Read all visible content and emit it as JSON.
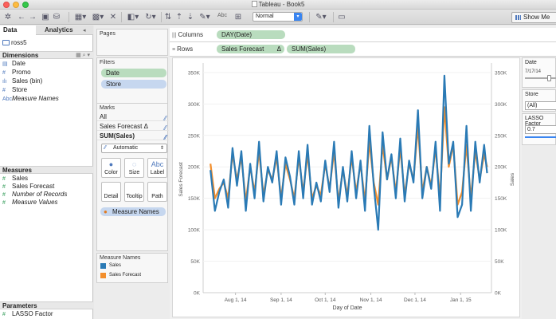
{
  "window": {
    "title": "Tableau - Book5"
  },
  "toolbar": {
    "format_select": "Normal",
    "abc_label": "Abc",
    "show_me": "Show Me"
  },
  "data_pane": {
    "tab_data": "Data",
    "tab_analytics": "Analytics",
    "datasource": "ross5",
    "dimensions_header": "Dimensions",
    "dimensions": [
      {
        "icon": "calendar-icon",
        "label": "Date"
      },
      {
        "icon": "number-icon",
        "label": "Promo"
      },
      {
        "icon": "bin-icon",
        "label": "Sales (bin)"
      },
      {
        "icon": "number-icon",
        "label": "Store"
      },
      {
        "icon": "abc-icon",
        "label": "Measure Names"
      }
    ],
    "measures_header": "Measures",
    "measures": [
      {
        "icon": "number-icon",
        "label": "Sales"
      },
      {
        "icon": "number-icon",
        "label": "Sales Forecast"
      },
      {
        "icon": "number-icon",
        "label": "Number of Records"
      },
      {
        "icon": "number-icon",
        "label": "Measure Values"
      }
    ],
    "parameters_header": "Parameters",
    "parameters": [
      {
        "icon": "number-icon",
        "label": "LASSO Factor"
      }
    ]
  },
  "shelves": {
    "pages_title": "Pages",
    "filters_title": "Filters",
    "filters": [
      "Date",
      "Store"
    ],
    "marks_title": "Marks",
    "marks_rows": [
      "All",
      "Sales Forecast Δ",
      "SUM(Sales)"
    ],
    "mark_type": "Automatic",
    "mark_buttons": [
      "Color",
      "Size",
      "Label",
      "Detail",
      "Tooltip",
      "Path"
    ],
    "color_pill": "Measure Names",
    "legend_title": "Measure Names",
    "legend": [
      {
        "label": "Sales",
        "color": "#2a7ab5"
      },
      {
        "label": "Sales Forecast",
        "color": "#f28e2c"
      }
    ]
  },
  "columns_shelf": {
    "label": "Columns",
    "pills": [
      "DAY(Date)"
    ]
  },
  "rows_shelf": {
    "label": "Rows",
    "pills": [
      "Sales Forecast",
      "Δ",
      "SUM(Sales)"
    ]
  },
  "right_panel": {
    "date_title": "Date",
    "date_value": "7/17/14",
    "store_title": "Store",
    "store_value": "(All)",
    "lasso_title": "LASSO Factor",
    "lasso_value": "0.7"
  },
  "chart_data": {
    "type": "line",
    "xlabel": "Day of Date",
    "ylabel": "Sales Forecast",
    "ylabel_right": "Sales",
    "ylim": [
      0,
      360000
    ],
    "yticks": [
      0,
      50000,
      100000,
      150000,
      200000,
      250000,
      300000,
      350000
    ],
    "ytick_labels": [
      "0K",
      "50K",
      "100K",
      "150K",
      "200K",
      "250K",
      "300K",
      "350K"
    ],
    "xticks": [
      "2014-08-01",
      "2014-09-01",
      "2014-10-01",
      "2014-11-01",
      "2014-12-01",
      "2015-01-01"
    ],
    "xtick_labels": [
      "Aug 1, 14",
      "Sep 1, 14",
      "Oct 1, 14",
      "Nov 1, 14",
      "Dec 1, 14",
      "Jan 1, 15"
    ],
    "xlim": [
      "2014-07-10",
      "2015-01-22"
    ],
    "series": [
      {
        "name": "Sales",
        "color": "#2a7ab5",
        "points": [
          [
            "2014-07-15",
            195000
          ],
          [
            "2014-07-18",
            130000
          ],
          [
            "2014-07-21",
            160000
          ],
          [
            "2014-07-24",
            180000
          ],
          [
            "2014-07-27",
            135000
          ],
          [
            "2014-07-30",
            230000
          ],
          [
            "2014-08-02",
            170000
          ],
          [
            "2014-08-05",
            225000
          ],
          [
            "2014-08-08",
            130000
          ],
          [
            "2014-08-11",
            205000
          ],
          [
            "2014-08-14",
            150000
          ],
          [
            "2014-08-17",
            240000
          ],
          [
            "2014-08-20",
            145000
          ],
          [
            "2014-08-23",
            200000
          ],
          [
            "2014-08-26",
            175000
          ],
          [
            "2014-08-29",
            225000
          ],
          [
            "2014-09-01",
            140000
          ],
          [
            "2014-09-04",
            215000
          ],
          [
            "2014-09-07",
            185000
          ],
          [
            "2014-09-10",
            140000
          ],
          [
            "2014-09-13",
            225000
          ],
          [
            "2014-09-16",
            150000
          ],
          [
            "2014-09-19",
            235000
          ],
          [
            "2014-09-22",
            140000
          ],
          [
            "2014-09-25",
            175000
          ],
          [
            "2014-09-28",
            145000
          ],
          [
            "2014-10-01",
            210000
          ],
          [
            "2014-10-04",
            160000
          ],
          [
            "2014-10-07",
            240000
          ],
          [
            "2014-10-10",
            135000
          ],
          [
            "2014-10-13",
            200000
          ],
          [
            "2014-10-16",
            145000
          ],
          [
            "2014-10-19",
            225000
          ],
          [
            "2014-10-22",
            150000
          ],
          [
            "2014-10-25",
            210000
          ],
          [
            "2014-10-28",
            130000
          ],
          [
            "2014-10-31",
            265000
          ],
          [
            "2014-11-03",
            170000
          ],
          [
            "2014-11-06",
            100000
          ],
          [
            "2014-11-09",
            255000
          ],
          [
            "2014-11-12",
            180000
          ],
          [
            "2014-11-15",
            220000
          ],
          [
            "2014-11-18",
            150000
          ],
          [
            "2014-11-21",
            245000
          ],
          [
            "2014-11-24",
            145000
          ],
          [
            "2014-11-27",
            210000
          ],
          [
            "2014-11-30",
            175000
          ],
          [
            "2014-12-03",
            290000
          ],
          [
            "2014-12-06",
            150000
          ],
          [
            "2014-12-09",
            200000
          ],
          [
            "2014-12-12",
            165000
          ],
          [
            "2014-12-15",
            240000
          ],
          [
            "2014-12-18",
            130000
          ],
          [
            "2014-12-21",
            345000
          ],
          [
            "2014-12-24",
            205000
          ],
          [
            "2014-12-27",
            240000
          ],
          [
            "2014-12-30",
            120000
          ],
          [
            "2015-01-02",
            140000
          ],
          [
            "2015-01-05",
            265000
          ],
          [
            "2015-01-08",
            130000
          ],
          [
            "2015-01-11",
            240000
          ],
          [
            "2015-01-14",
            175000
          ],
          [
            "2015-01-17",
            235000
          ],
          [
            "2015-01-19",
            190000
          ]
        ]
      },
      {
        "name": "Sales Forecast",
        "color": "#f28e2c",
        "points": [
          [
            "2014-07-15",
            205000
          ],
          [
            "2014-07-18",
            150000
          ],
          [
            "2014-07-21",
            165000
          ],
          [
            "2014-07-24",
            175000
          ],
          [
            "2014-07-27",
            150000
          ],
          [
            "2014-07-30",
            220000
          ],
          [
            "2014-08-02",
            180000
          ],
          [
            "2014-08-05",
            215000
          ],
          [
            "2014-08-08",
            145000
          ],
          [
            "2014-08-11",
            200000
          ],
          [
            "2014-08-14",
            160000
          ],
          [
            "2014-08-17",
            225000
          ],
          [
            "2014-08-20",
            155000
          ],
          [
            "2014-08-23",
            195000
          ],
          [
            "2014-08-26",
            180000
          ],
          [
            "2014-08-29",
            215000
          ],
          [
            "2014-09-01",
            150000
          ],
          [
            "2014-09-04",
            205000
          ],
          [
            "2014-09-07",
            180000
          ],
          [
            "2014-09-10",
            150000
          ],
          [
            "2014-09-13",
            215000
          ],
          [
            "2014-09-16",
            160000
          ],
          [
            "2014-09-19",
            220000
          ],
          [
            "2014-09-22",
            150000
          ],
          [
            "2014-09-25",
            170000
          ],
          [
            "2014-09-28",
            155000
          ],
          [
            "2014-10-01",
            205000
          ],
          [
            "2014-10-04",
            165000
          ],
          [
            "2014-10-07",
            225000
          ],
          [
            "2014-10-10",
            145000
          ],
          [
            "2014-10-13",
            195000
          ],
          [
            "2014-10-16",
            155000
          ],
          [
            "2014-10-19",
            215000
          ],
          [
            "2014-10-22",
            160000
          ],
          [
            "2014-10-25",
            205000
          ],
          [
            "2014-10-28",
            145000
          ],
          [
            "2014-10-31",
            240000
          ],
          [
            "2014-11-03",
            175000
          ],
          [
            "2014-11-06",
            140000
          ],
          [
            "2014-11-09",
            235000
          ],
          [
            "2014-11-12",
            180000
          ],
          [
            "2014-11-15",
            215000
          ],
          [
            "2014-11-18",
            160000
          ],
          [
            "2014-11-21",
            230000
          ],
          [
            "2014-11-24",
            155000
          ],
          [
            "2014-11-27",
            205000
          ],
          [
            "2014-11-30",
            180000
          ],
          [
            "2014-12-03",
            265000
          ],
          [
            "2014-12-06",
            160000
          ],
          [
            "2014-12-09",
            200000
          ],
          [
            "2014-12-12",
            170000
          ],
          [
            "2014-12-15",
            230000
          ],
          [
            "2014-12-18",
            150000
          ],
          [
            "2014-12-21",
            295000
          ],
          [
            "2014-12-24",
            200000
          ],
          [
            "2014-12-27",
            235000
          ],
          [
            "2014-12-30",
            140000
          ],
          [
            "2015-01-02",
            160000
          ],
          [
            "2015-01-05",
            235000
          ],
          [
            "2015-01-08",
            150000
          ],
          [
            "2015-01-11",
            225000
          ],
          [
            "2015-01-14",
            180000
          ],
          [
            "2015-01-17",
            220000
          ],
          [
            "2015-01-19",
            200000
          ]
        ]
      }
    ]
  }
}
